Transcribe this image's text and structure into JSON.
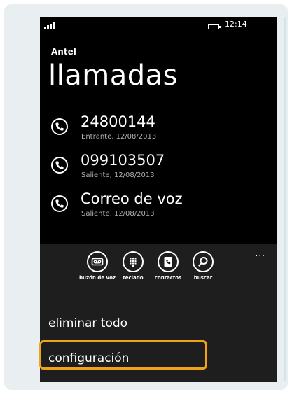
{
  "status": {
    "time": "12:14"
  },
  "header": {
    "carrier": "Antel",
    "title": "llamadas"
  },
  "calls": [
    {
      "number": "24800144",
      "detail": "Entrante, 12/08/2013",
      "icon": "phone-icon"
    },
    {
      "number": "099103507",
      "detail": "Saliente, 12/08/2013",
      "icon": "phone-icon"
    },
    {
      "number": "Correo de voz",
      "detail": "Saliente, 12/08/2013",
      "icon": "phone-icon"
    }
  ],
  "appbar": {
    "more": "...",
    "buttons": [
      {
        "label": "buzón de voz",
        "icon": "voicemail-icon"
      },
      {
        "label": "teclado",
        "icon": "keypad-icon"
      },
      {
        "label": "contactos",
        "icon": "contacts-icon"
      },
      {
        "label": "buscar",
        "icon": "search-icon"
      }
    ],
    "menu": [
      "eliminar todo",
      "configuración"
    ]
  },
  "colors": {
    "highlight": "#f2a219",
    "appbar": "#1e1e1e"
  }
}
